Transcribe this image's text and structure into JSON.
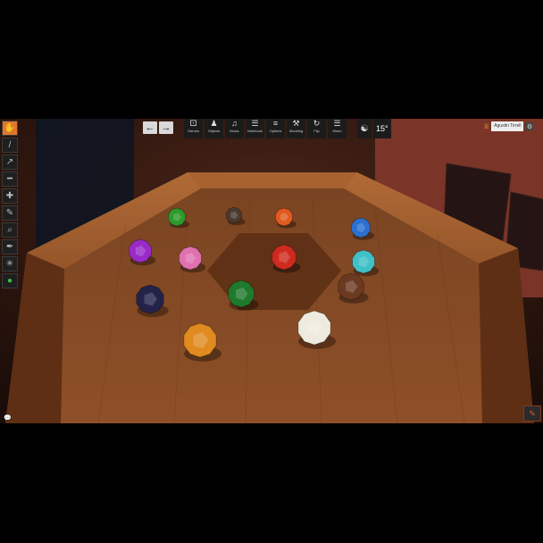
{
  "toolbar": {
    "back_icon": "arrow-left-icon",
    "forward_icon": "arrow-right-icon",
    "menus": [
      {
        "key": "games",
        "label": "Games",
        "icon": "games-icon"
      },
      {
        "key": "objects",
        "label": "Objects",
        "icon": "objects-icon"
      },
      {
        "key": "music",
        "label": "Music",
        "icon": "music-icon"
      },
      {
        "key": "notebook",
        "label": "Notebook",
        "icon": "notebook-icon"
      },
      {
        "key": "options",
        "label": "Options",
        "icon": "options-icon"
      },
      {
        "key": "modding",
        "label": "Modding",
        "icon": "modding-icon"
      },
      {
        "key": "flip",
        "label": "Flip",
        "icon": "flip-icon"
      },
      {
        "key": "menu",
        "label": "Menu",
        "icon": "menu-icon"
      }
    ],
    "rotation_value": "15°"
  },
  "player": {
    "name": "Agustin Tirrell"
  },
  "tools": [
    {
      "key": "grab",
      "icon": "hand-icon",
      "active": true
    },
    {
      "key": "line",
      "icon": "line-icon"
    },
    {
      "key": "flick",
      "icon": "flick-icon"
    },
    {
      "key": "ruler",
      "icon": "ruler-icon"
    },
    {
      "key": "gizmo",
      "icon": "gizmo-icon"
    },
    {
      "key": "draw",
      "icon": "pencil-icon"
    },
    {
      "key": "zoom",
      "icon": "zoom-icon"
    },
    {
      "key": "pen",
      "icon": "pen-icon"
    },
    {
      "key": "vector",
      "icon": "vector-icon"
    },
    {
      "key": "color",
      "icon": "color-dot-icon"
    }
  ],
  "dice": [
    {
      "color": "#2c9a2c",
      "label": "d12"
    },
    {
      "color": "#4a3a30",
      "label": "d12"
    },
    {
      "color": "#e05a20",
      "label": "d12"
    },
    {
      "color": "#2a70d0",
      "label": "d12"
    },
    {
      "color": "#9a2ac8",
      "label": "d12"
    },
    {
      "color": "#e070b0",
      "label": "d12"
    },
    {
      "color": "#d02a1e",
      "label": "d12"
    },
    {
      "color": "#40c0c8",
      "label": "d12"
    },
    {
      "color": "#23234a",
      "label": "d12"
    },
    {
      "color": "#1f7a2c",
      "label": "d12"
    },
    {
      "color": "#6b3a20",
      "label": "d12"
    },
    {
      "color": "#e08a20",
      "label": "d12"
    },
    {
      "color": "#efeae0",
      "label": "d12"
    }
  ],
  "colors": {
    "accent": "#e0782a",
    "table_wood": "#8a4a22",
    "felt": "#7a4020"
  }
}
